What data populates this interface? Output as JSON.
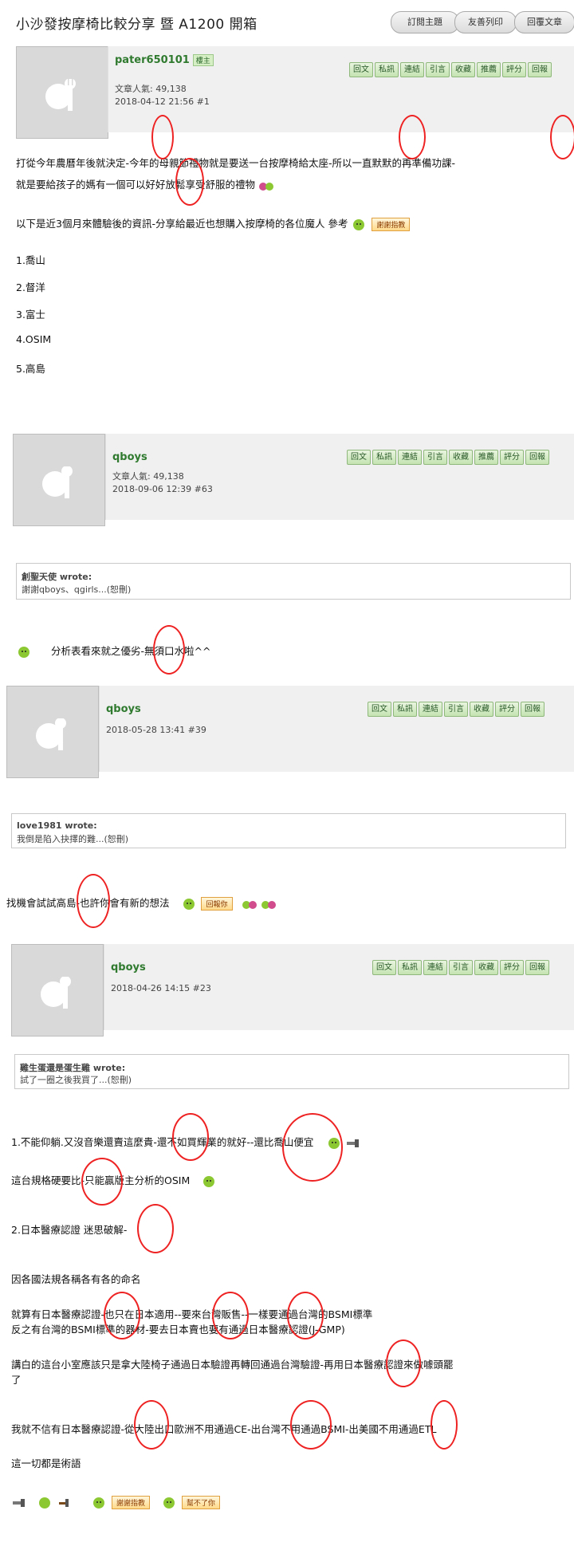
{
  "title": "小沙發按摩椅比較分享 暨 A1200 開箱",
  "top_buttons": [
    "訂閱主題",
    "友善列印",
    "回覆文章"
  ],
  "actions": [
    "回文",
    "私訊",
    "連結",
    "引言",
    "收藏",
    "推薦",
    "評分",
    "回報"
  ],
  "actions_short": [
    "回文",
    "私訊",
    "連結",
    "引言",
    "收藏",
    "評分",
    "回報"
  ],
  "post1": {
    "user": "pater650101",
    "badge": "樓主",
    "popularity": "文章人氣: 49,138",
    "date": "2018-04-12 21:56 #1",
    "lines": [
      "打從今年農曆年後就決定-今年的母親節禮物就是要送一台按摩椅給太座-所以一直默默的再準備功課-",
      "就是要給孩子的媽有一個可以好好放鬆享受舒服的禮物",
      "以下是近3個月來體驗後的資訊-分享給最近也想購入按摩椅的各位魔人 參考",
      "1.喬山",
      "2.督洋",
      "3.富士",
      "4.OSIM",
      "5.高島"
    ],
    "tag": "謝謝指教"
  },
  "post2": {
    "user": "qboys",
    "popularity": "文章人氣: 49,138",
    "date": "2018-09-06 12:39 #63",
    "quote_author": "創聖天使 wrote:",
    "quote_text": "謝謝qboys、qgirls...(恕刪)",
    "reply": "分析表看來就之優劣-無須口水啦^^"
  },
  "post3": {
    "user": "qboys",
    "date": "2018-05-28 13:41 #39",
    "quote_author": "love1981 wrote:",
    "quote_text": "我倒是陷入抉擇的難...(恕刪)",
    "reply": "找機會試試高島-也許你會有新的想法",
    "tag": "回報你"
  },
  "post4": {
    "user": "qboys",
    "date": "2018-04-26 14:15 #23",
    "quote_author": "雞生蛋還是蛋生雞 wrote:",
    "quote_text": "試了一圈之後我買了...(恕刪)",
    "lines": [
      "1.不能仰躺.又沒音樂還賣這麼貴-還不如買輝業的就好--還比喬山便宜",
      "這台規格硬要比-只能贏版主分析的OSIM",
      "2.日本醫療認證 迷思破解-",
      "因各國法規各稱各有各的命名",
      "就算有日本醫療認證-也只在日本適用--要來台灣販售--一樣要通過台灣的BSMI標準",
      "反之有台灣的BSMI標準的器材-要去日本賣也要有通過日本醫療認證(J-GMP)",
      "講白的這台小室應該只是拿大陸椅子通過日本驗證再轉回通過台灣驗證-再用日本醫療認證來做噱頭罷",
      "了",
      "我就不信有日本醫療認證-從大陸出口歐洲不用通過CE-出台灣不用通過BSMI-出美國不用通過ETL",
      "這一切都是術語"
    ],
    "tag1": "謝謝指教",
    "tag2": "幫不了你"
  },
  "colors": {
    "accent_green": "#2f7a2f",
    "circle_red": "#e22222"
  }
}
